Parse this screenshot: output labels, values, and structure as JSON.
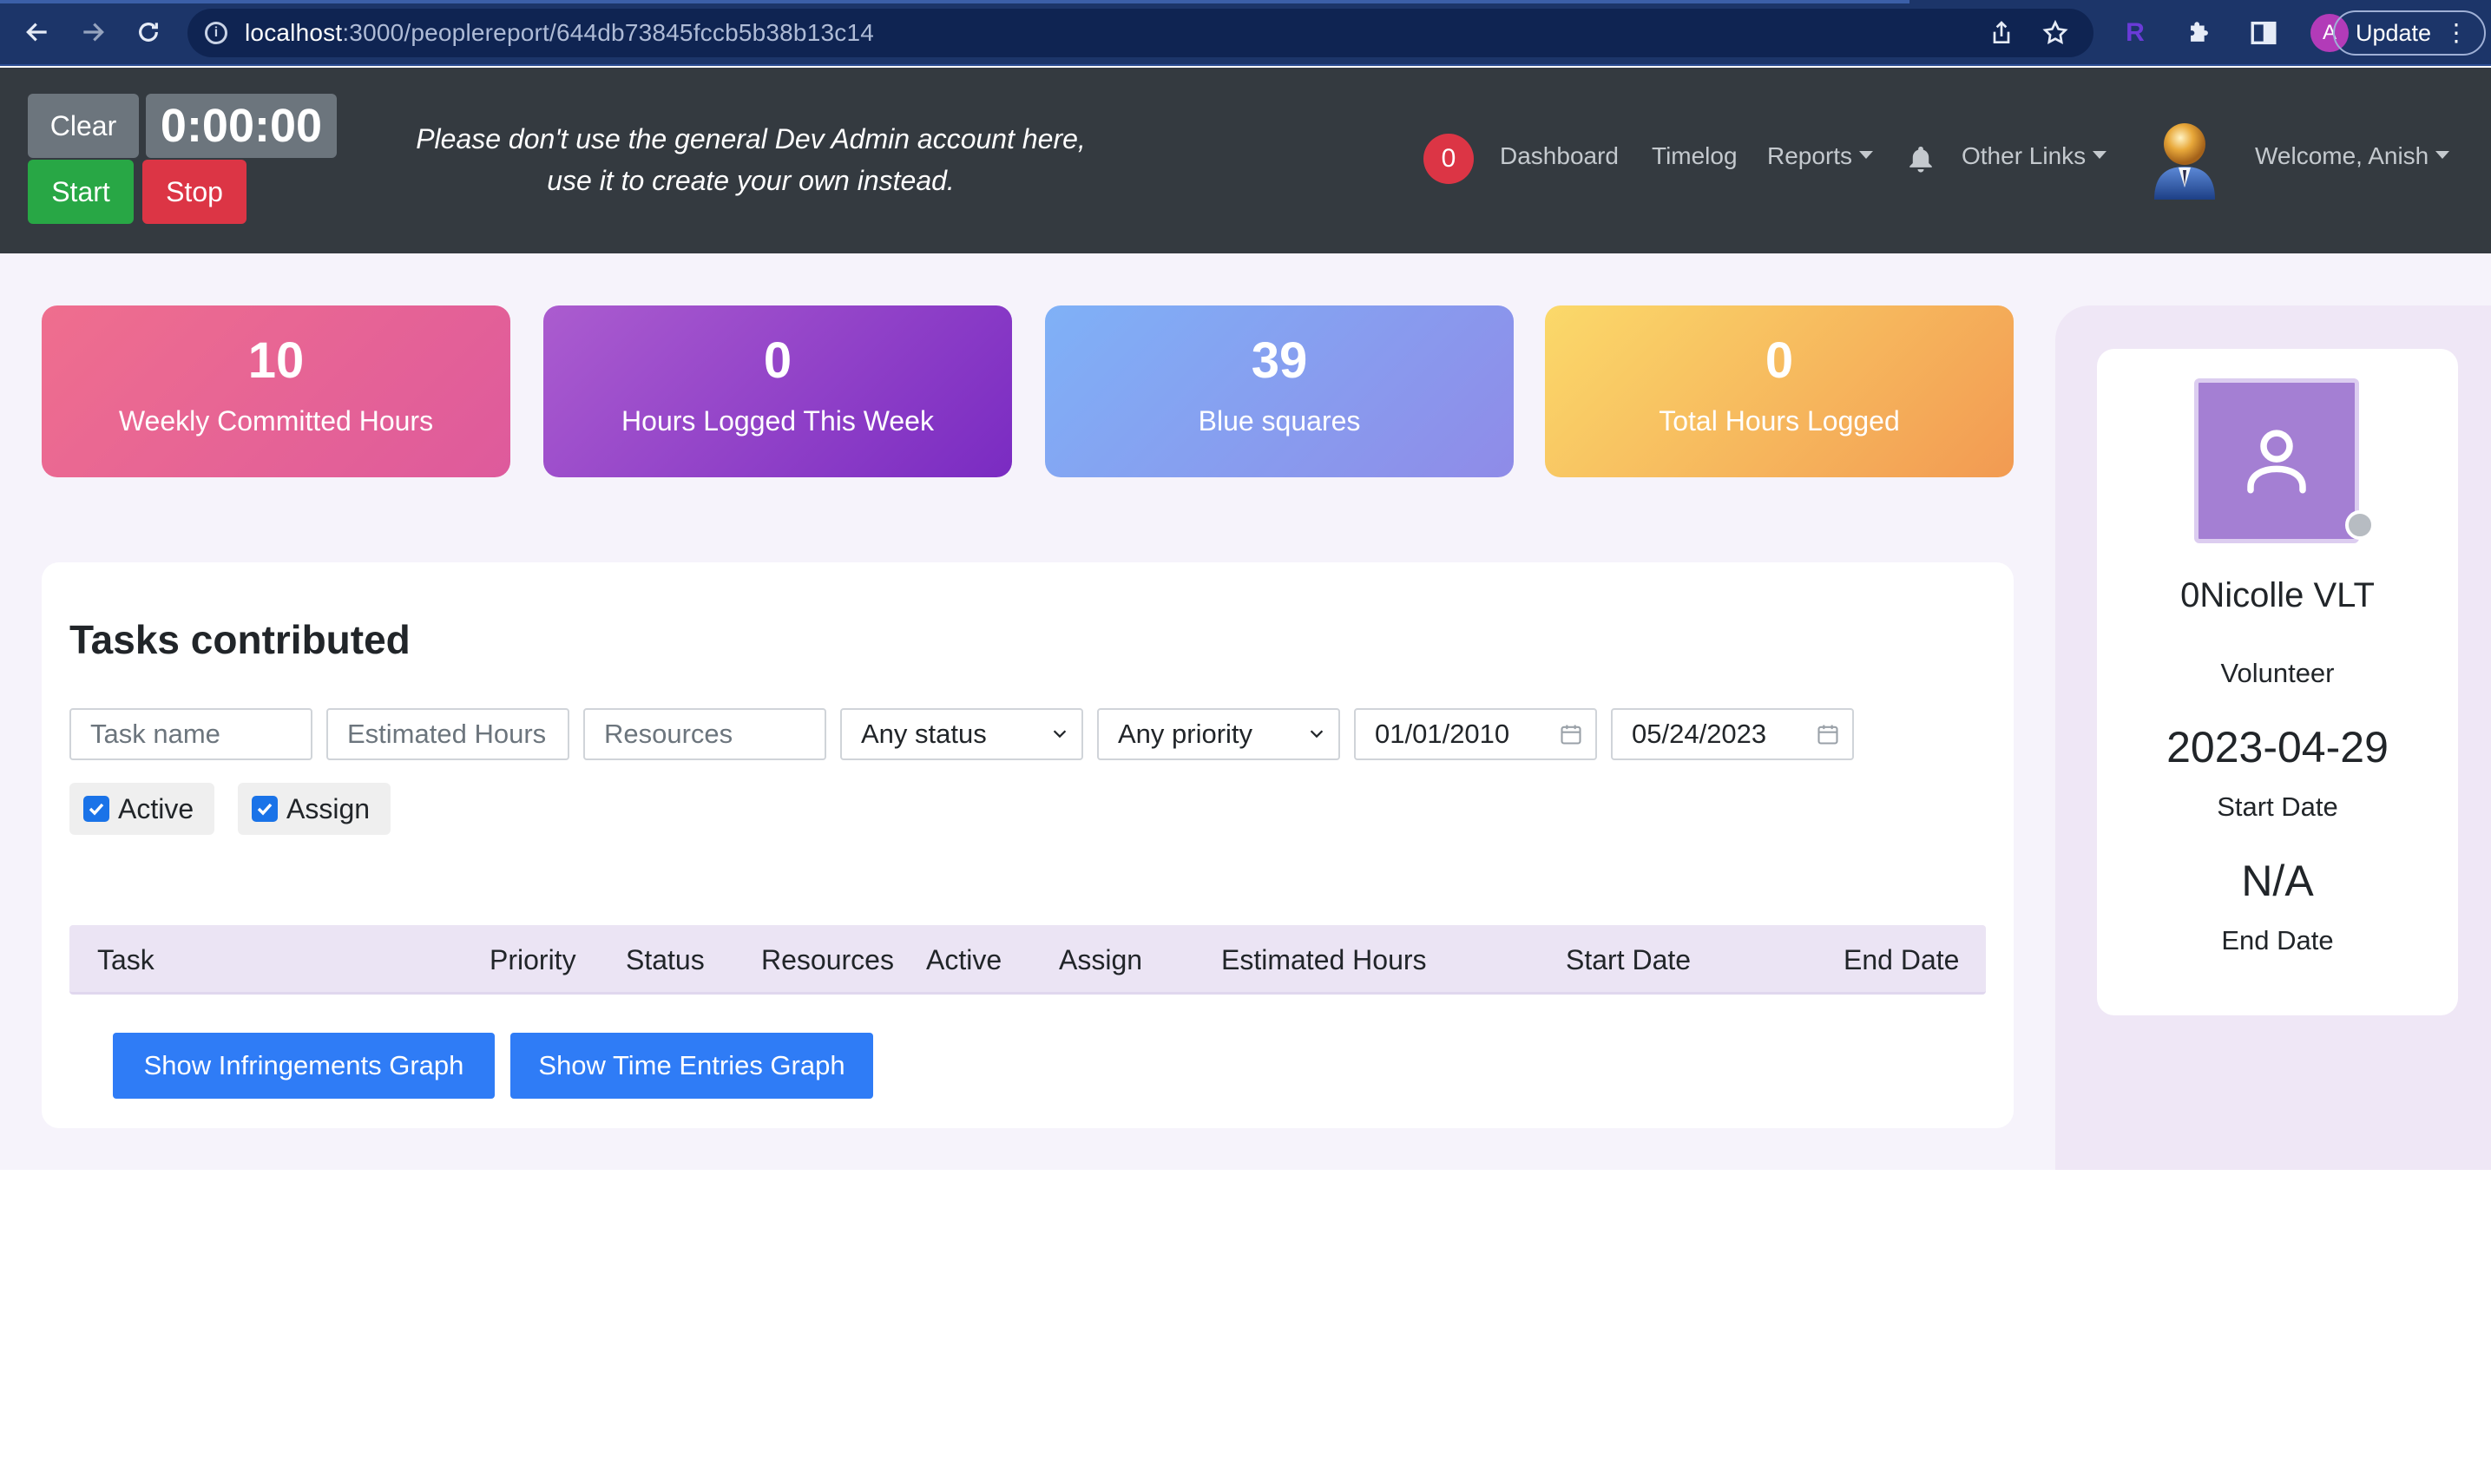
{
  "browser": {
    "url_host": "localhost",
    "url_path": ":3000/peoplereport/644db73845fccb5b38b13c14",
    "extension_letter": "R",
    "profile_initial": "A",
    "update_label": "Update"
  },
  "timer": {
    "clear_label": "Clear",
    "display": "0:00:00",
    "start_label": "Start",
    "stop_label": "Stop"
  },
  "header": {
    "notice_line1": "Please don't use the general Dev Admin account here,",
    "notice_line2": "use it to create your own instead.",
    "notification_count": "0",
    "nav": {
      "dashboard": "Dashboard",
      "timelog": "Timelog",
      "reports": "Reports",
      "other_links": "Other Links",
      "welcome": "Welcome, Anish"
    }
  },
  "stats": [
    {
      "value": "10",
      "label": "Weekly Committed Hours",
      "color": "#e5668f"
    },
    {
      "value": "0",
      "label": "Hours Logged This Week",
      "color": "#9046c8"
    },
    {
      "value": "39",
      "label": "Blue squares",
      "color": "#879ef0"
    },
    {
      "value": "0",
      "label": "Total Hours Logged",
      "color": "#f6b95d"
    }
  ],
  "tasks": {
    "title": "Tasks contributed",
    "filters": {
      "task_name_placeholder": "Task name",
      "estimated_hours_placeholder": "Estimated Hours",
      "resources_placeholder": "Resources",
      "status_value": "Any status",
      "priority_value": "Any priority",
      "from_date": "01/01/2010",
      "to_date": "05/24/2023",
      "active_label": "Active",
      "active_checked": true,
      "assign_label": "Assign",
      "assign_checked": true
    },
    "columns": [
      "Task",
      "Priority",
      "Status",
      "Resources",
      "Active",
      "Assign",
      "Estimated Hours",
      "Start Date",
      "End Date"
    ],
    "rows": [],
    "infringements_button": "Show Infringements Graph",
    "time_entries_button": "Show Time Entries Graph"
  },
  "profile": {
    "name": "0Nicolle VLT",
    "role": "Volunteer",
    "start_date": "2023-04-29",
    "start_label": "Start Date",
    "end_date": "N/A",
    "end_label": "End Date",
    "status": "offline"
  },
  "colors": {
    "header_bg": "#343a40",
    "primary_button": "#2f7cf6",
    "start_green": "#28a745",
    "stop_red": "#dc3545",
    "page_bg": "#f6f3fb"
  }
}
